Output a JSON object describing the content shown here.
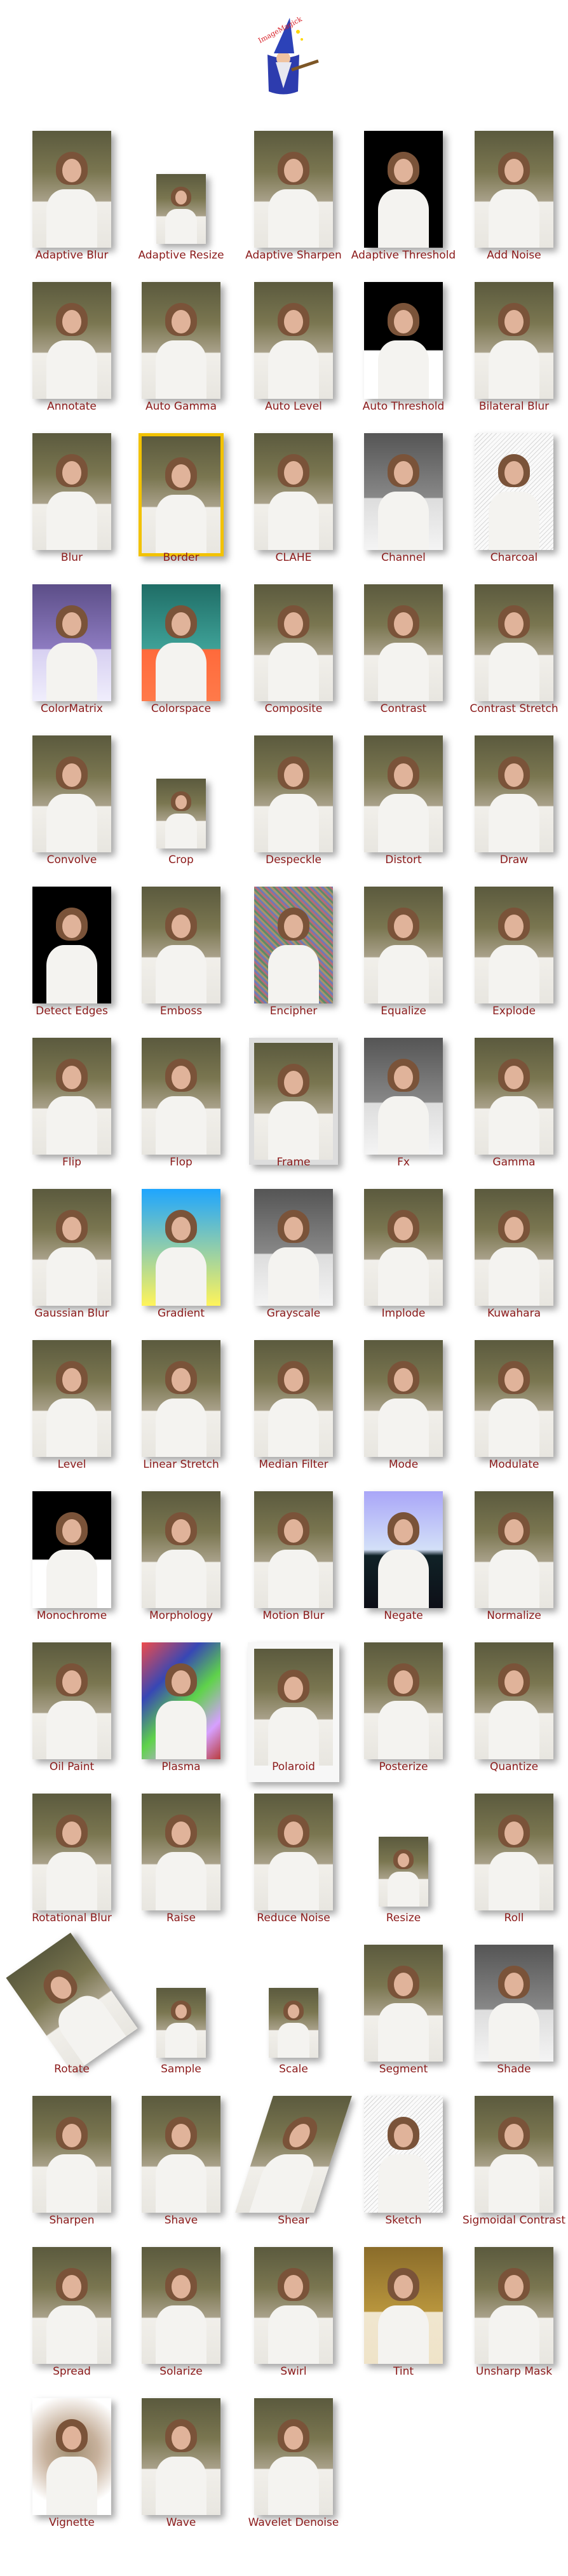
{
  "effects": [
    {
      "label": "Adaptive Blur",
      "style": "normal"
    },
    {
      "label": "Adaptive Resize",
      "style": "small"
    },
    {
      "label": "Adaptive Sharpen",
      "style": "normal"
    },
    {
      "label": "Adaptive Threshold",
      "style": "threshold"
    },
    {
      "label": "Add Noise",
      "style": "normal"
    },
    {
      "label": "Annotate",
      "style": "normal"
    },
    {
      "label": "Auto Gamma",
      "style": "normal"
    },
    {
      "label": "Auto Level",
      "style": "normal"
    },
    {
      "label": "Auto Threshold",
      "style": "mono"
    },
    {
      "label": "Bilateral Blur",
      "style": "normal"
    },
    {
      "label": "Blur",
      "style": "normal"
    },
    {
      "label": "Border",
      "style": "border"
    },
    {
      "label": "CLAHE",
      "style": "normal"
    },
    {
      "label": "Channel",
      "style": "gray"
    },
    {
      "label": "Charcoal",
      "style": "sketch"
    },
    {
      "label": "ColorMatrix",
      "style": "purple"
    },
    {
      "label": "Colorspace",
      "style": "cyan"
    },
    {
      "label": "Composite",
      "style": "normal"
    },
    {
      "label": "Contrast",
      "style": "normal"
    },
    {
      "label": "Contrast Stretch",
      "style": "normal"
    },
    {
      "label": "Convolve",
      "style": "normal"
    },
    {
      "label": "Crop",
      "style": "small"
    },
    {
      "label": "Despeckle",
      "style": "normal"
    },
    {
      "label": "Distort",
      "style": "normal"
    },
    {
      "label": "Draw",
      "style": "normal"
    },
    {
      "label": "Detect Edges",
      "style": "threshold"
    },
    {
      "label": "Emboss",
      "style": "normal"
    },
    {
      "label": "Encipher",
      "style": "noise"
    },
    {
      "label": "Equalize",
      "style": "normal"
    },
    {
      "label": "Explode",
      "style": "normal"
    },
    {
      "label": "Flip",
      "style": "normal"
    },
    {
      "label": "Flop",
      "style": "normal"
    },
    {
      "label": "Frame",
      "style": "frame"
    },
    {
      "label": "Fx",
      "style": "gray"
    },
    {
      "label": "Gamma",
      "style": "normal"
    },
    {
      "label": "Gaussian Blur",
      "style": "normal"
    },
    {
      "label": "Gradient",
      "style": "gradient"
    },
    {
      "label": "Grayscale",
      "style": "gray"
    },
    {
      "label": "Implode",
      "style": "normal"
    },
    {
      "label": "Kuwahara",
      "style": "normal"
    },
    {
      "label": "Level",
      "style": "normal"
    },
    {
      "label": "Linear Stretch",
      "style": "normal"
    },
    {
      "label": "Median Filter",
      "style": "normal"
    },
    {
      "label": "Mode",
      "style": "normal"
    },
    {
      "label": "Modulate",
      "style": "normal"
    },
    {
      "label": "Monochrome",
      "style": "mono"
    },
    {
      "label": "Morphology",
      "style": "normal"
    },
    {
      "label": "Motion Blur",
      "style": "normal"
    },
    {
      "label": "Negate",
      "style": "negate"
    },
    {
      "label": "Normalize",
      "style": "normal"
    },
    {
      "label": "Oil Paint",
      "style": "normal"
    },
    {
      "label": "Plasma",
      "style": "plasma"
    },
    {
      "label": "Polaroid",
      "style": "polaroid"
    },
    {
      "label": "Posterize",
      "style": "normal"
    },
    {
      "label": "Quantize",
      "style": "normal"
    },
    {
      "label": "Rotational Blur",
      "style": "normal"
    },
    {
      "label": "Raise",
      "style": "normal"
    },
    {
      "label": "Reduce Noise",
      "style": "normal"
    },
    {
      "label": "Resize",
      "style": "small"
    },
    {
      "label": "Roll",
      "style": "normal"
    },
    {
      "label": "Rotate",
      "style": "rotate"
    },
    {
      "label": "Sample",
      "style": "small"
    },
    {
      "label": "Scale",
      "style": "small"
    },
    {
      "label": "Segment",
      "style": "normal"
    },
    {
      "label": "Shade",
      "style": "gray"
    },
    {
      "label": "Sharpen",
      "style": "normal"
    },
    {
      "label": "Shave",
      "style": "normal"
    },
    {
      "label": "Shear",
      "style": "shear"
    },
    {
      "label": "Sketch",
      "style": "sketch"
    },
    {
      "label": "Sigmoidal Contrast",
      "style": "normal"
    },
    {
      "label": "Spread",
      "style": "normal"
    },
    {
      "label": "Solarize",
      "style": "normal"
    },
    {
      "label": "Swirl",
      "style": "normal"
    },
    {
      "label": "Tint",
      "style": "tint"
    },
    {
      "label": "Unsharp Mask",
      "style": "normal"
    },
    {
      "label": "Vignette",
      "style": "vignette"
    },
    {
      "label": "Wave",
      "style": "normal"
    },
    {
      "label": "Wavelet Denoise",
      "style": "normal"
    }
  ],
  "logo": {
    "name": "imagemagick-wizard-logo",
    "text": "ImageMagick"
  },
  "colors": {
    "label": "#8b1a1a",
    "background": "#ffffff"
  }
}
